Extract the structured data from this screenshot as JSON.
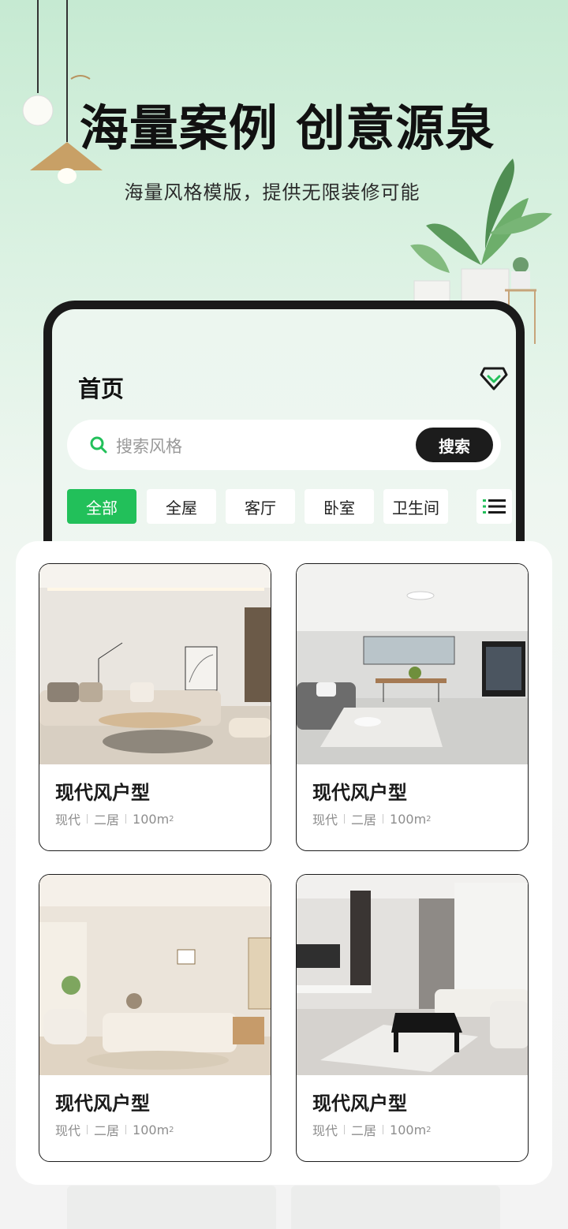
{
  "hero": {
    "title": "海量案例 创意源泉",
    "subtitle": "海量风格模版，提供无限装修可能"
  },
  "phone": {
    "page_title": "首页",
    "vip_icon": "diamond-icon",
    "search": {
      "placeholder": "搜索风格",
      "button_label": "搜索"
    },
    "tabs": [
      {
        "label": "全部",
        "active": true
      },
      {
        "label": "全屋",
        "active": false
      },
      {
        "label": "客厅",
        "active": false
      },
      {
        "label": "卧室",
        "active": false
      },
      {
        "label": "卫生间",
        "active": false
      }
    ],
    "menu_icon": "list-icon"
  },
  "cards": [
    {
      "title": "现代风户型",
      "style": "现代",
      "rooms": "二居",
      "area": "100m",
      "area_unit_sup": "2"
    },
    {
      "title": "现代风户型",
      "style": "现代",
      "rooms": "二居",
      "area": "100m",
      "area_unit_sup": "2"
    },
    {
      "title": "现代风户型",
      "style": "现代",
      "rooms": "二居",
      "area": "100m",
      "area_unit_sup": "2"
    },
    {
      "title": "现代风户型",
      "style": "现代",
      "rooms": "二居",
      "area": "100m",
      "area_unit_sup": "2"
    }
  ],
  "colors": {
    "accent": "#22c05a",
    "dark": "#1c1c1c",
    "hero_bg_top": "#c6ead2"
  }
}
